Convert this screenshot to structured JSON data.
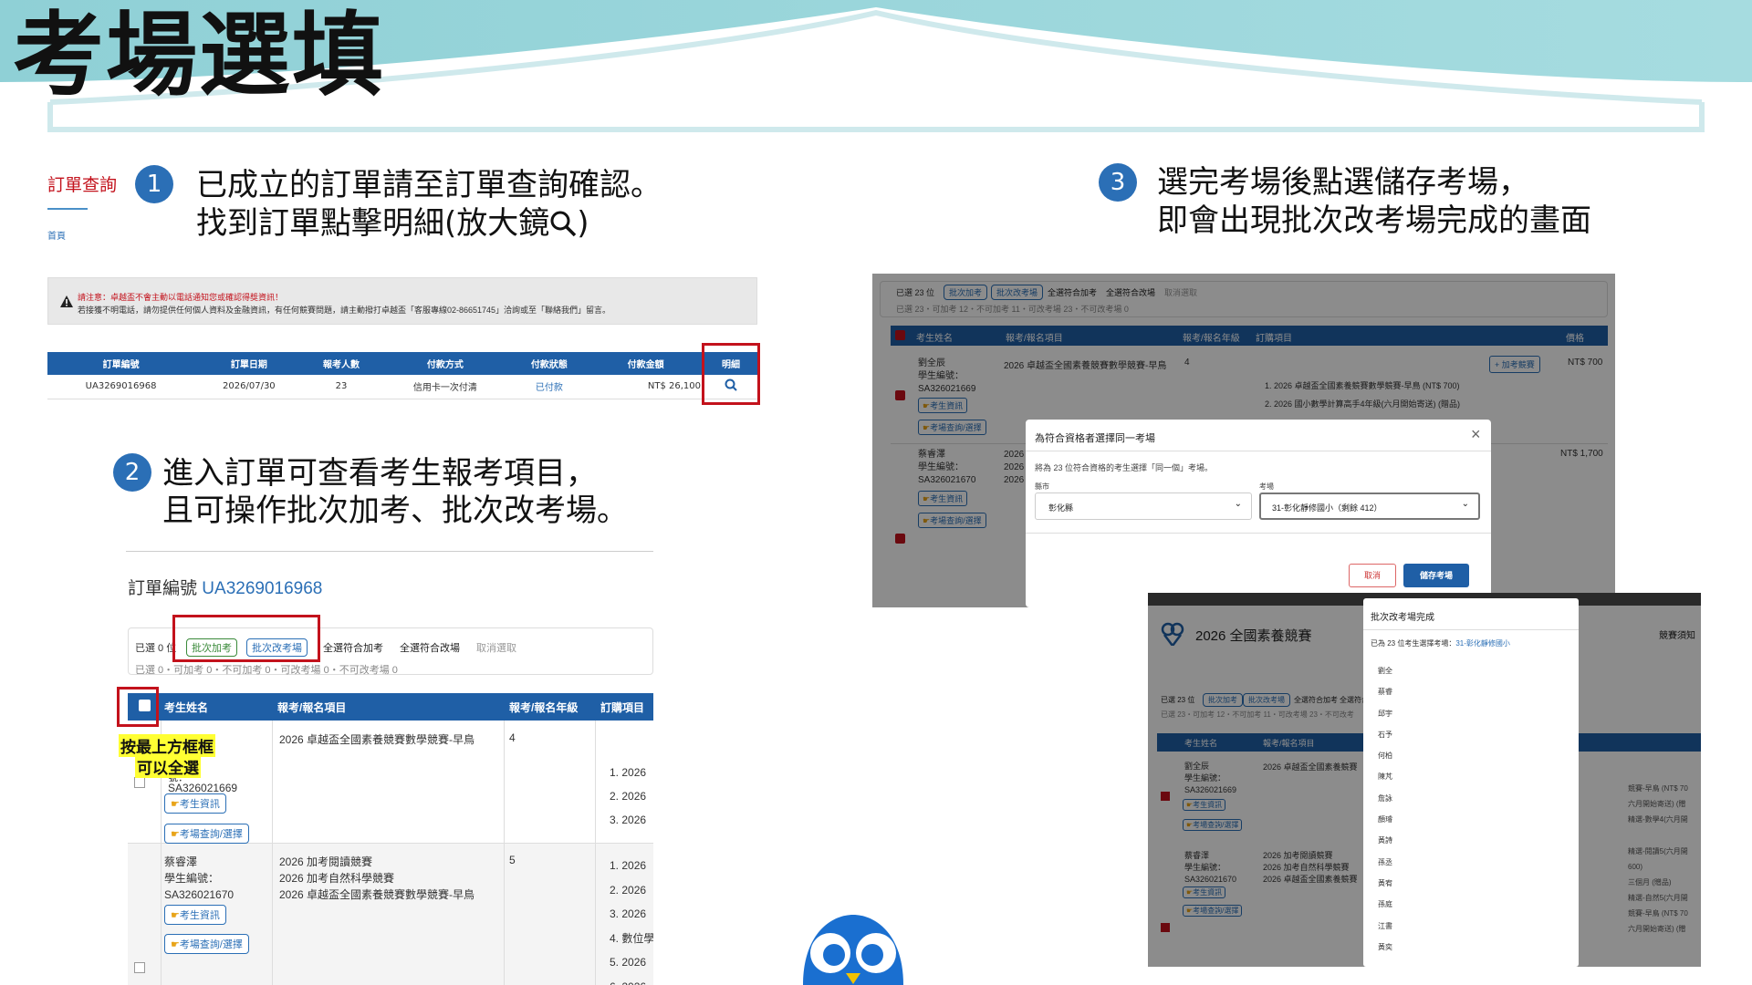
{
  "slide": {
    "title": "考場選填"
  },
  "left_nav": {
    "order_query": "訂單查詢",
    "home": "首頁"
  },
  "steps": [
    {
      "number": "1",
      "line1": "已成立的訂單請至訂單查詢確認。",
      "line2": "找到訂單點擊明細(放大鏡"
    },
    {
      "number": "2",
      "line1": "進入訂單可查看考生報考項目，",
      "line2": "且可操作批次加考、批次改考場。"
    },
    {
      "number": "3",
      "line1": "選完考場後點選儲存考場，",
      "line2": "即會出現批次改考場完成的畫面"
    }
  ],
  "step1_close": ")",
  "notice": {
    "line1": "請注意：卓越盃不會主動以電話通知您或確認得獎資訊！",
    "line2": "若接獲不明電話，請勿提供任何個人資料及金融資訊，有任何競賽問題，請主動撥打卓越盃「客服專線02-86651745」洽詢或至「聯絡我們」留言。"
  },
  "orders_table": {
    "headers": [
      "訂單編號",
      "訂單日期",
      "報考人數",
      "付款方式",
      "付款狀態",
      "付款金額",
      "明細"
    ],
    "row": [
      "UA3269016968",
      "2026/07/30",
      "23",
      "信用卡一次付清",
      "已付款",
      "NT$ 26,100"
    ]
  },
  "order_detail": {
    "label": "訂單編號",
    "order_no": "UA3269016968",
    "selected": "已選 0 位",
    "batch_add": "批次加考",
    "batch_change": "批次改考場",
    "select_add": "全選符合加考",
    "select_change": "全選符合改場",
    "cancel": "取消選取",
    "stats": "已選 0・可加考 0・不可加考 0・可改考場 0・不可改考場 0",
    "headers": [
      "考生姓名",
      "報考/報名項目",
      "報考/報名年級",
      "訂購項目"
    ],
    "annotation_line1": "按最上方框框",
    "annotation_line2": "可以全選",
    "rows": [
      {
        "name": "",
        "id_label": "號：",
        "id": "SA326021669",
        "projects": [
          "2026 卓越盃全國素養競賽數學競賽-早鳥"
        ],
        "grade": "4",
        "items": [
          "1. 2026",
          "2. 2026",
          "3. 2026"
        ]
      },
      {
        "name": "蔡睿澤",
        "id_label": "學生編號：",
        "id": "SA326021670",
        "projects": [
          "2026 加考閱讀競賽",
          "2026 加考自然科學競賽",
          "2026 卓越盃全國素養競賽數學競賽-早鳥"
        ],
        "grade": "5",
        "items": [
          "1. 2026",
          "2. 2026",
          "3. 2026",
          "4. 數位學",
          "5. 2026",
          "6. 2026"
        ]
      }
    ],
    "student_info": "考生資訊",
    "venue_btn": "考場查詢/選擇"
  },
  "modal_shot": {
    "selected": "已選 23 位",
    "batch_add": "批次加考",
    "batch_change": "批次改考場",
    "select_add": "全選符合加考",
    "select_change": "全選符合改場",
    "cancel": "取消選取",
    "stats": "已選 23・可加考 12・不可加考 11・可改考場 23・不可改考場 0",
    "headers": [
      "考生姓名",
      "報考/報名項目",
      "報考/報名年級",
      "訂購項目",
      "價格"
    ],
    "row1": {
      "name": "劉全辰",
      "id_label": "學生編號：",
      "id": "SA326021669",
      "project": "2026 卓越盃全國素養競賽數學競賽-早鳥",
      "grade": "4",
      "add_btn": "+ 加考競賽",
      "item1": "1. 2026 卓越盃全國素養競賽數學競賽-早鳥 (NT$ 700)",
      "item2": "2. 2026 國小數學計算高手4年級(六月開始寄送) (贈品)",
      "price": "NT$ 700"
    },
    "row2": {
      "name": "蔡睿澤",
      "id_label": "學生編號：",
      "id": "SA326021670",
      "price": "NT$ 1,700",
      "p1": "2026",
      "p2": "2026",
      "p3": "2026"
    },
    "student_info": "考生資訊",
    "venue_btn": "考場查詢/選擇",
    "modal": {
      "title": "為符合資格者選擇同一考場",
      "desc": "將為 23 位符合資格的考生選擇「同一個」考場。",
      "county_label": "縣市",
      "county": "彰化縣",
      "venue_label": "考場",
      "venue": "31-彰化靜修國小（剩餘 412）",
      "cancel": "取消",
      "save": "儲存考場"
    }
  },
  "result_shot": {
    "brand": "2026 全國素養競賽",
    "menu": "競賽須知",
    "selected": "已選 23 位",
    "batch_add": "批次加考",
    "batch_change": "批次改考場",
    "select_add": "全選符合加考",
    "select_change": "全選符合改場",
    "stats": "已選 23・可加考 12・不可加考 11・可改考場 23・不可改考",
    "headers": [
      "考生姓名",
      "報考/報名項目"
    ],
    "r1": {
      "name": "劉全辰",
      "id_label": "學生編號：",
      "id": "SA326021669",
      "project": "2026 卓越盃全國素養競賽"
    },
    "r2": {
      "name": "蔡睿澤",
      "id_label": "學生編號：",
      "id": "SA326021670",
      "p1": "2026 加考閱讀競賽",
      "p2": "2026 加考自然科學競賽",
      "p3": "2026 卓越盃全國素養競賽"
    },
    "right_cut": [
      "競賽-早鳥 (NT$ 70",
      "六月開始寄送) (贈",
      "精選-數學4(六月開",
      "精選-閱讀5(六月開",
      "600)",
      "三個月 (贈品)",
      "精選-自然5(六月開",
      "競賽-早鳥 (NT$ 70",
      "六月開始寄送) (贈"
    ],
    "student_info": "考生資訊",
    "venue_btn": "考場查詢/選擇",
    "popup": {
      "title": "批次改考場完成",
      "msg_prefix": "已為 23 位考生選擇考場：",
      "msg_venue": "31-彰化靜修國小",
      "names": [
        "劉全",
        "蔡睿",
        "邱宇",
        "石予",
        "何柏",
        "陳芃",
        "詹詠",
        "顏璿",
        "黃詩",
        "孫丞",
        "黃宥",
        "孫庭",
        "江書",
        "黃奕"
      ]
    }
  },
  "colors": {
    "header_blue": "#1f5fa6",
    "title_teal": "#8fd0d6",
    "accent_red": "#c3121c",
    "link_blue": "#2b6fb6"
  }
}
